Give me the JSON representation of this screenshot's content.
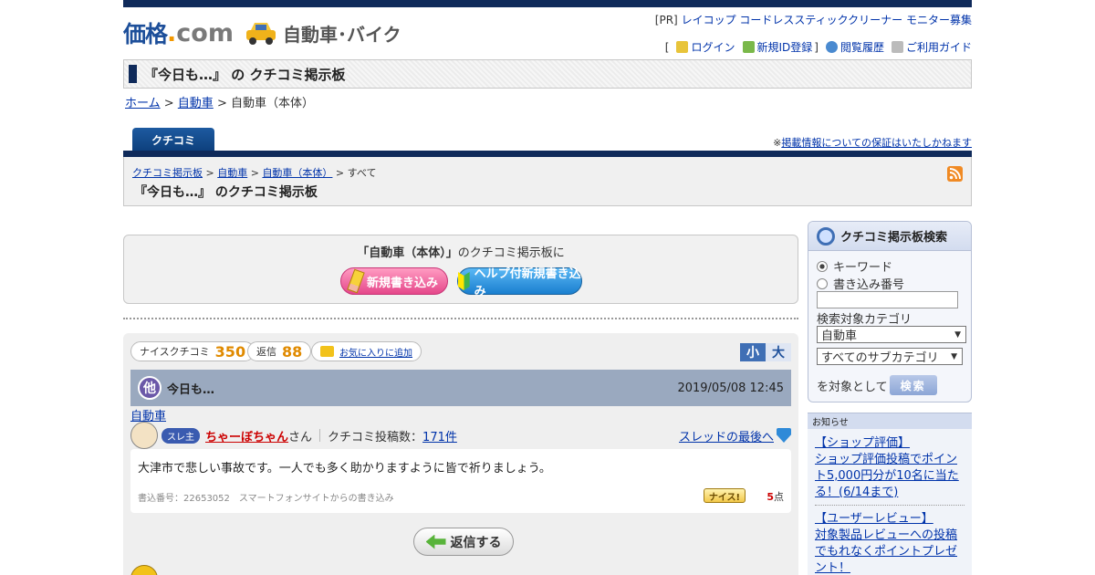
{
  "header": {
    "logo_main": "価格",
    "logo_dot": ".",
    "logo_com": "com",
    "section_title": "自動車･バイク",
    "pr_label": "[PR]",
    "pr_text": "レイコップ コードレススティッククリーナー モニター募集",
    "nav_open": "[",
    "nav_close": "]",
    "nav": {
      "login": "ログイン",
      "signup": "新規ID登録",
      "history": "閲覧履歴",
      "guide": "ご利用ガイド"
    }
  },
  "title_bar": {
    "title": "『今日も…』 の クチコミ掲示板"
  },
  "breadcrumb": {
    "home": "ホーム",
    "sep1": " > ",
    "car": "自動車",
    "sep2": " > ",
    "current": "自動車（本体）"
  },
  "tab": {
    "label": "クチコミ"
  },
  "disclaimer": {
    "prefix": "※",
    "link": "掲載情報についての保証はいたしかねます"
  },
  "board_header": {
    "crumb_board": "クチコミ掲示板",
    "crumb_car": "自動車",
    "crumb_body": "自動車（本体）",
    "crumb_all": "すべて",
    "gt": " > ",
    "title": "『今日も…』 のクチコミ掲示板"
  },
  "post_box": {
    "lead_bold": "「自動車（本体）」",
    "lead_rest": "のクチコミ掲示板に",
    "new_post": "新規書き込み",
    "help_post": "ヘルプ付新規書き込み"
  },
  "thread": {
    "nice_label": "ナイスクチコミ",
    "nice_count": "350",
    "reply_label": "返信",
    "reply_count": "88",
    "favorite": "お気に入りに追加",
    "size_small": "小",
    "size_large": "大",
    "other_icon": "他",
    "title": "今日も…",
    "datetime": "2019/05/08 12:45",
    "category": "自動車",
    "badge": "スレ主",
    "user": "ちゃーぼちゃん",
    "honorific": "さん",
    "post_count_label": "クチコミ投稿数：",
    "post_count": "171件",
    "to_last": "スレッドの最後へ",
    "body": "大津市で悲しい事故です。一人でも多く助かりますように皆で祈りましょう。",
    "meta": "書込番号：22653052　スマートフォンサイトからの書き込み",
    "nice_btn": "ナイス!",
    "points": "5",
    "points_unit": "点",
    "reply_btn": "返信する"
  },
  "search": {
    "title": "クチコミ掲示板検索",
    "opt_keyword": "キーワード",
    "opt_number": "書き込み番号",
    "keyword_value": "",
    "category_label": "検索対象カテゴリ",
    "category_value": "自動車",
    "subcategory_value": "すべてのサブカテゴリ",
    "target_label": "を対象として",
    "search_btn": "検索"
  },
  "notice": {
    "title": "お知らせ",
    "item1_head": "【ショップ評価】",
    "item1_body": "ショップ評価投稿でポイント5,000円分が10名に当たる！(6/14まで)",
    "item2_head": "【ユーザーレビュー】",
    "item2_body": "対象製品レビューへの投稿でもれなくポイントプレゼント！"
  },
  "colors": {
    "navy": "#0f2a5a",
    "link": "#0033aa",
    "nice_orange": "#e08a00"
  }
}
